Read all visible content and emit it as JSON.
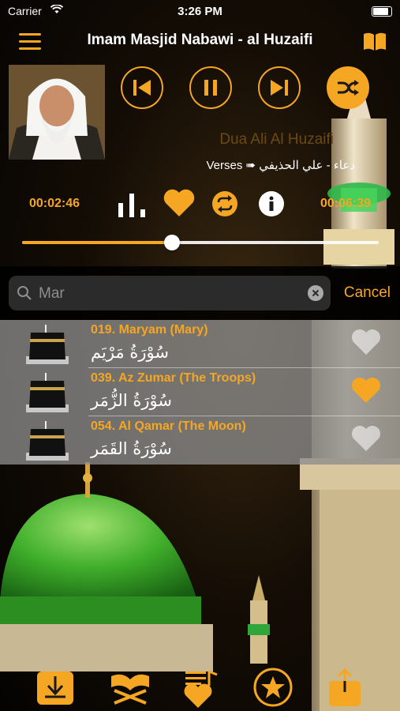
{
  "status_bar": {
    "carrier": "Carrier",
    "time": "3:26 PM"
  },
  "nav": {
    "title": "Imam Masjid Nabawi - al Huzaifi"
  },
  "player": {
    "track_title": "Dua Ali Al Huzaifi",
    "track_subtitle": "Verses ➠ دعاء - علي الحذيفي",
    "elapsed": "00:02:46",
    "total": "00:06:39",
    "progress": 0.42
  },
  "search": {
    "query": "Mar",
    "cancel_label": "Cancel"
  },
  "results": [
    {
      "title": "019. Maryam (Mary)",
      "arabic": "سُوْرَةُ مَرْيَم",
      "favorite": false
    },
    {
      "title": "039. Az Zumar (The Troops)",
      "arabic": "سُوْرَةُ الزُّمَر",
      "favorite": true
    },
    {
      "title": "054. Al Qamar (The Moon)",
      "arabic": "سُوْرَةُ القَمَر",
      "favorite": false
    }
  ],
  "colors": {
    "accent": "#f5a623",
    "dome_green": "#3fae2a"
  },
  "icons": [
    "menu-icon",
    "book-icon",
    "previous-icon",
    "pause-icon",
    "next-icon",
    "shuffle-icon",
    "equalizer-icon",
    "heart-icon",
    "repeat-icon",
    "info-icon",
    "search-icon",
    "clear-icon",
    "download-icon",
    "quran-stand-icon",
    "playlist-heart-icon",
    "star-icon",
    "share-icon"
  ]
}
